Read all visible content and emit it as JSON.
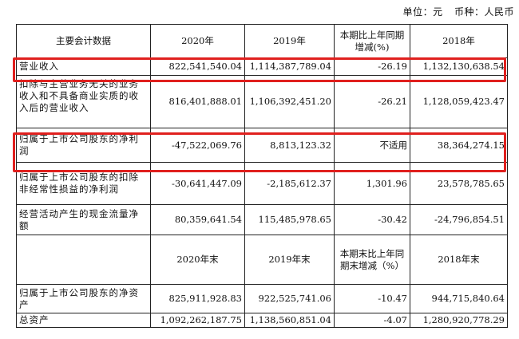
{
  "header": {
    "unit": "单位：元",
    "currency": "币种：人民币"
  },
  "columns": [
    "主要会计数据",
    "2020年",
    "2019年",
    "本期比上年同期增减(%)",
    "2018年"
  ],
  "rows": [
    {
      "label": "营业收入",
      "y2020": "822,541,540.04",
      "y2019": "1,114,387,789.04",
      "change": "-26.19",
      "y2018": "1,132,130,638.54"
    },
    {
      "label": "扣除与主营业务无关的业务收入和不具备商业实质的收入后的营业收入",
      "y2020": "816,401,888.01",
      "y2019": "1,106,392,451.20",
      "change": "-26.21",
      "y2018": "1,128,059,423.47"
    },
    {
      "label": "归属于上市公司股东的净利润",
      "y2020": "-47,522,069.76",
      "y2019": "8,813,123.32",
      "change": "不适用",
      "y2018": "38,364,274.15"
    },
    {
      "label": "归属于上市公司股东的扣除非经常性损益的净利润",
      "y2020": "-30,641,447.09",
      "y2019": "-2,185,612.37",
      "change": "1,301.96",
      "y2018": "23,578,785.65"
    },
    {
      "label": "经营活动产生的现金流量净额",
      "y2020": "80,359,641.54",
      "y2019": "115,485,978.65",
      "change": "-30.42",
      "y2018": "-24,796,854.51"
    }
  ],
  "columns2": [
    "",
    "2020年末",
    "2019年末",
    "本期末比上年同期末增减（%）",
    "2018年末"
  ],
  "rows2": [
    {
      "label": "归属于上市公司股东的净资产",
      "y2020": "825,911,928.83",
      "y2019": "922,525,741.06",
      "change": "-10.47",
      "y2018": "944,715,840.64"
    },
    {
      "label": "总资产",
      "y2020": "1,092,262,187.75",
      "y2019": "1,138,560,851.04",
      "change": "-4.07",
      "y2018": "1,280,920,778.29"
    }
  ],
  "highlight_color": "#e0201e"
}
